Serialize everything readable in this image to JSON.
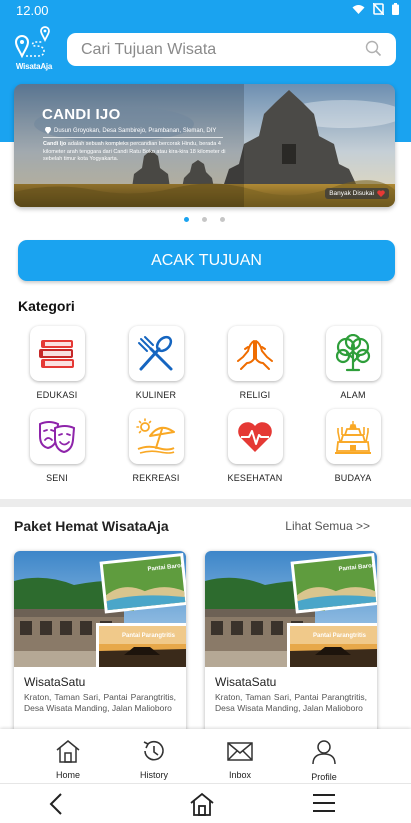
{
  "status": {
    "time": "12.00"
  },
  "brand": {
    "logo_text": "WisataAja"
  },
  "search": {
    "placeholder": "Cari Tujuan Wisata"
  },
  "banner": {
    "title": "CANDI IJO",
    "location": "Dusun Groyokan, Desa Sambirejo, Prambanan, Sleman, DIY",
    "desc_bold": "Candi Ijo",
    "desc": " adalah sebuah kompleks percandian bercorak Hindu, berada 4 kilometer arah tenggara dari Candi Ratu Boko atau kira-kira 18 kilometer di sebelah timur kota Yogyakarta.",
    "badge": "Banyak Disukai"
  },
  "random_button": "ACAK TUJUAN",
  "categories": {
    "title": "Kategori",
    "items": [
      {
        "label": "EDUKASI",
        "icon": "books-icon"
      },
      {
        "label": "KULINER",
        "icon": "utensils-icon"
      },
      {
        "label": "RELIGI",
        "icon": "praying-hands-icon"
      },
      {
        "label": "ALAM",
        "icon": "tree-icon"
      },
      {
        "label": "SENI",
        "icon": "theater-masks-icon"
      },
      {
        "label": "REKREASI",
        "icon": "beach-umbrella-icon"
      },
      {
        "label": "KESEHATAN",
        "icon": "heart-pulse-icon"
      },
      {
        "label": "BUDAYA",
        "icon": "temple-icon"
      }
    ]
  },
  "packages": {
    "title": "Paket Hemat WisataAja",
    "see_all": "Lihat Semua >>",
    "items": [
      {
        "name": "WisataSatu",
        "desc": "Kraton, Taman Sari, Pantai Parangtritis, Desa Wisata Manding, Jalan Malioboro",
        "photo1": "Pantai Baron",
        "photo2": "Pantai Parangtritis"
      },
      {
        "name": "WisataSatu",
        "desc": "Kraton, Taman Sari, Pantai Parangtritis, Desa Wisata Manding, Jalan Malioboro",
        "photo1": "Pantai Baron",
        "photo2": "Pantai Parangtritis"
      }
    ]
  },
  "bottom_nav": {
    "home": "Home",
    "history": "History",
    "inbox": "Inbox",
    "profile": "Profile"
  },
  "colors": {
    "primary": "#1aa3f0",
    "heart": "#e53935"
  }
}
